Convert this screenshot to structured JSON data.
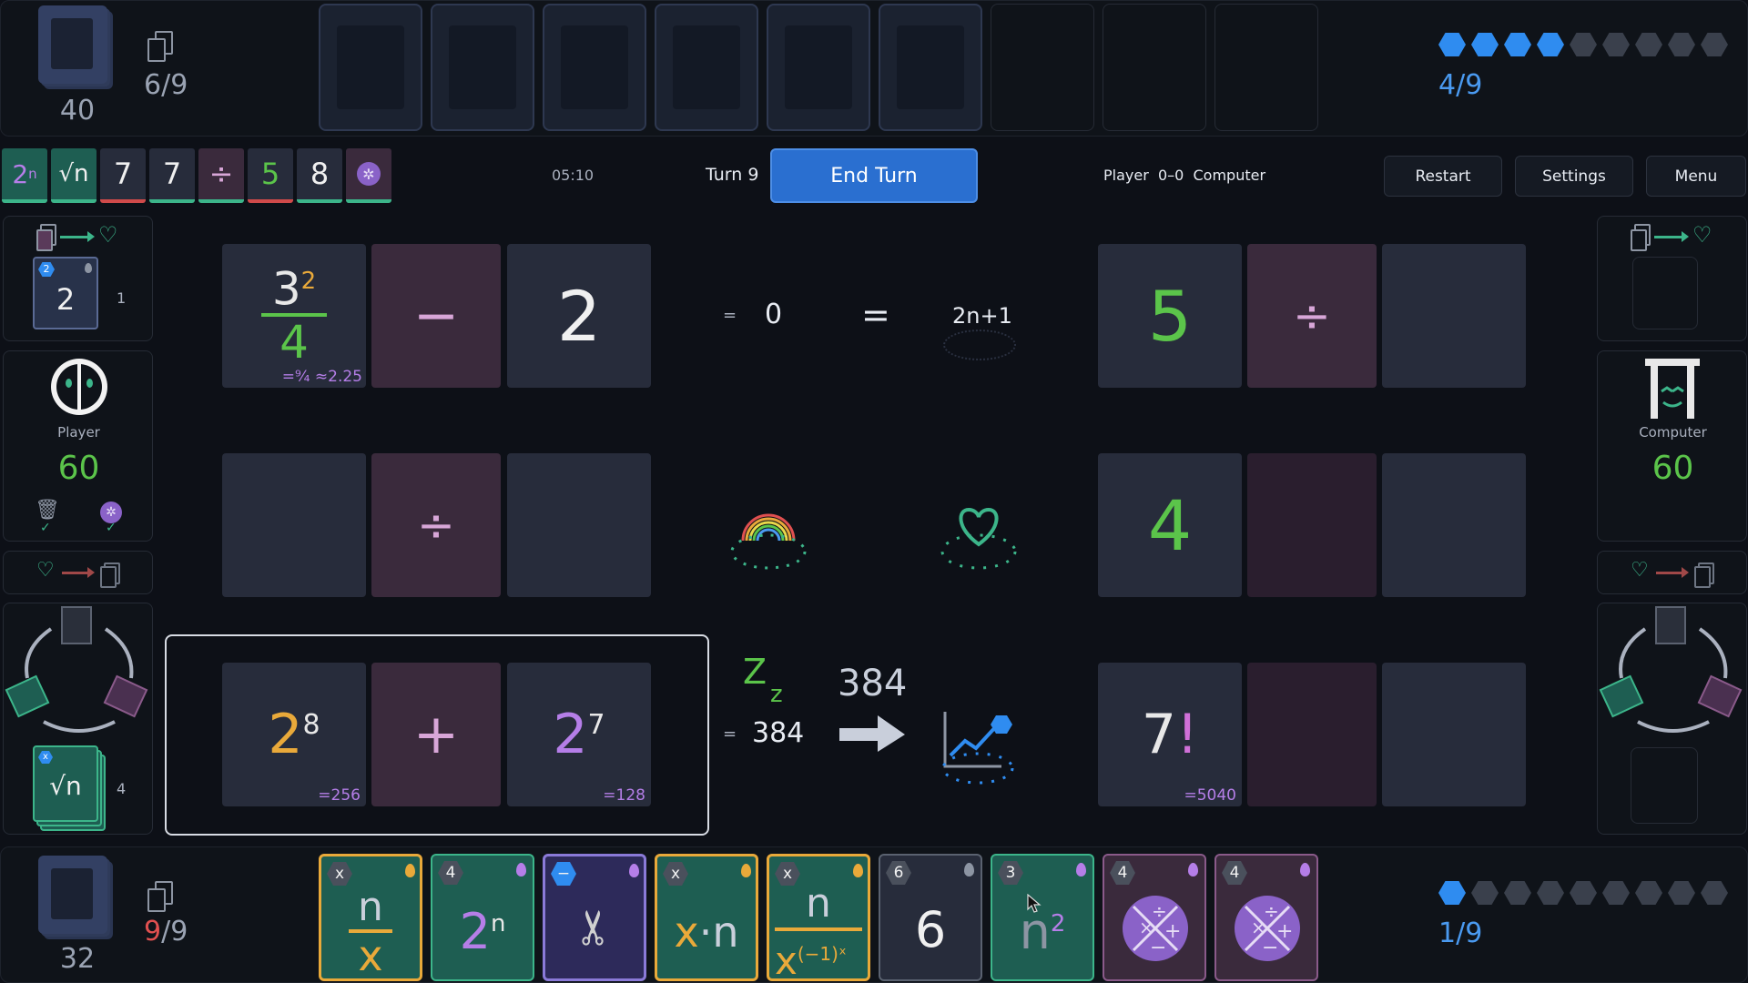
{
  "top": {
    "deck_count": "40",
    "hand_count": "6/9",
    "mana": {
      "text": "4/9",
      "filled": 4,
      "total": 9
    }
  },
  "toolbar": {
    "mini_cards": [
      "2ⁿ",
      "√n",
      "7",
      "7",
      "÷",
      "5",
      "8",
      "✲"
    ],
    "timer": "05:10",
    "turn": "Turn 9",
    "end_turn": "End Turn",
    "score": "Player  0–0  Computer",
    "restart": "Restart",
    "settings": "Settings",
    "menu": "Menu"
  },
  "player": {
    "name": "Player",
    "hp": "60",
    "queue_card": "2",
    "queue_count": "1",
    "cycle_count": "4"
  },
  "computer": {
    "name": "Computer",
    "hp": "60"
  },
  "board": {
    "row1": {
      "a_base": "3",
      "a_exp": "2",
      "a_den": "4",
      "a_note": "=⁹⁄₄ ≈2.25",
      "op": "−",
      "b": "2",
      "eq_small": "=",
      "result": "0",
      "eq_big": "=",
      "target": "2n+1",
      "c": "5",
      "c_op": "÷"
    },
    "row2": {
      "op": "÷",
      "c": "4"
    },
    "row3": {
      "a_base": "2",
      "a_exp": "8",
      "a_note": "=256",
      "op": "+",
      "b_base": "2",
      "b_exp": "7",
      "b_note": "=128",
      "sleep": "Z",
      "sleep2": "z",
      "eq_small": "=",
      "result": "384",
      "arrow_value": "384",
      "c": "7",
      "c_bang": "!",
      "c_note": "=5040"
    }
  },
  "bottom": {
    "deck_count": "32",
    "hand_count_red": "9",
    "hand_count_rest": "/9",
    "mana": {
      "text": "1/9",
      "filled": 1,
      "total": 9
    },
    "hand": [
      {
        "cost": "x",
        "text": "n/x"
      },
      {
        "cost": "4",
        "text": "2ⁿ"
      },
      {
        "cost": "−",
        "text": "✂"
      },
      {
        "cost": "x",
        "text": "x·n"
      },
      {
        "cost": "x",
        "text": "n/x^(−1)^x"
      },
      {
        "cost": "6",
        "text": "6"
      },
      {
        "cost": "3",
        "text": "n²"
      },
      {
        "cost": "4",
        "text": "×÷−+"
      },
      {
        "cost": "4",
        "text": "×÷−+"
      }
    ],
    "hand_labels": {
      "c1_top": "n",
      "c1_bot": "x",
      "c2_base": "2",
      "c2_exp": "n",
      "c4": "x·n",
      "c5_top": "n",
      "c5_bot": "x",
      "c5_exp": "(−1)ˣ",
      "c6": "6",
      "c7_base": "n",
      "c7_exp": "2"
    }
  },
  "colors": {
    "bg": "#0d1017",
    "mana": "#2f8cf0",
    "green": "#5bc44a",
    "gold": "#e9a93a",
    "purple": "#b57ee8",
    "button": "#2a6fd0"
  }
}
